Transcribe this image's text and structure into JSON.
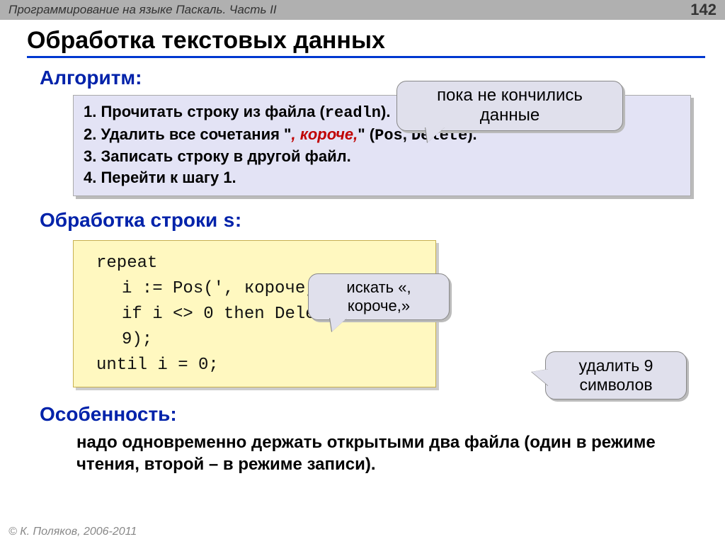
{
  "topbar": {
    "title": "Программирование на языке Паскаль. Часть II",
    "page": "142"
  },
  "heading": "Обработка текстовых данных",
  "section_alg": "Алгоритм:",
  "callout_top": "пока не кончились данные",
  "algo": {
    "s1a": "1. Прочитать строку из файла (",
    "s1b": "readln",
    "s1c": ").",
    "s2a": "2. Удалить все сочетания \"",
    "s2b": ", короче,",
    "s2c": "\" (",
    "s2d": "Pos",
    "s2e": ", ",
    "s2f": "Delete",
    "s2g": ").",
    "s3": "3. Записать строку в другой файл.",
    "s4": "4. Перейти к шагу 1."
  },
  "section_proc_a": "Обработка строки ",
  "section_proc_b": "s",
  "section_proc_c": ":",
  "callout_mid": "искать «, короче,»",
  "code": {
    "l1": "repeat",
    "l2": "i := Pos(', короче,', s);",
    "l3": "if i <> 0 then Delete(s, i, 9);",
    "l4": "until i = 0;"
  },
  "callout_right": "удалить 9 символов",
  "section_feat": "Особенность:",
  "feat_text": "надо одновременно держать открытыми два файла (один в режиме чтения, второй – в режиме записи).",
  "footer": "© К. Поляков, 2006-2011"
}
